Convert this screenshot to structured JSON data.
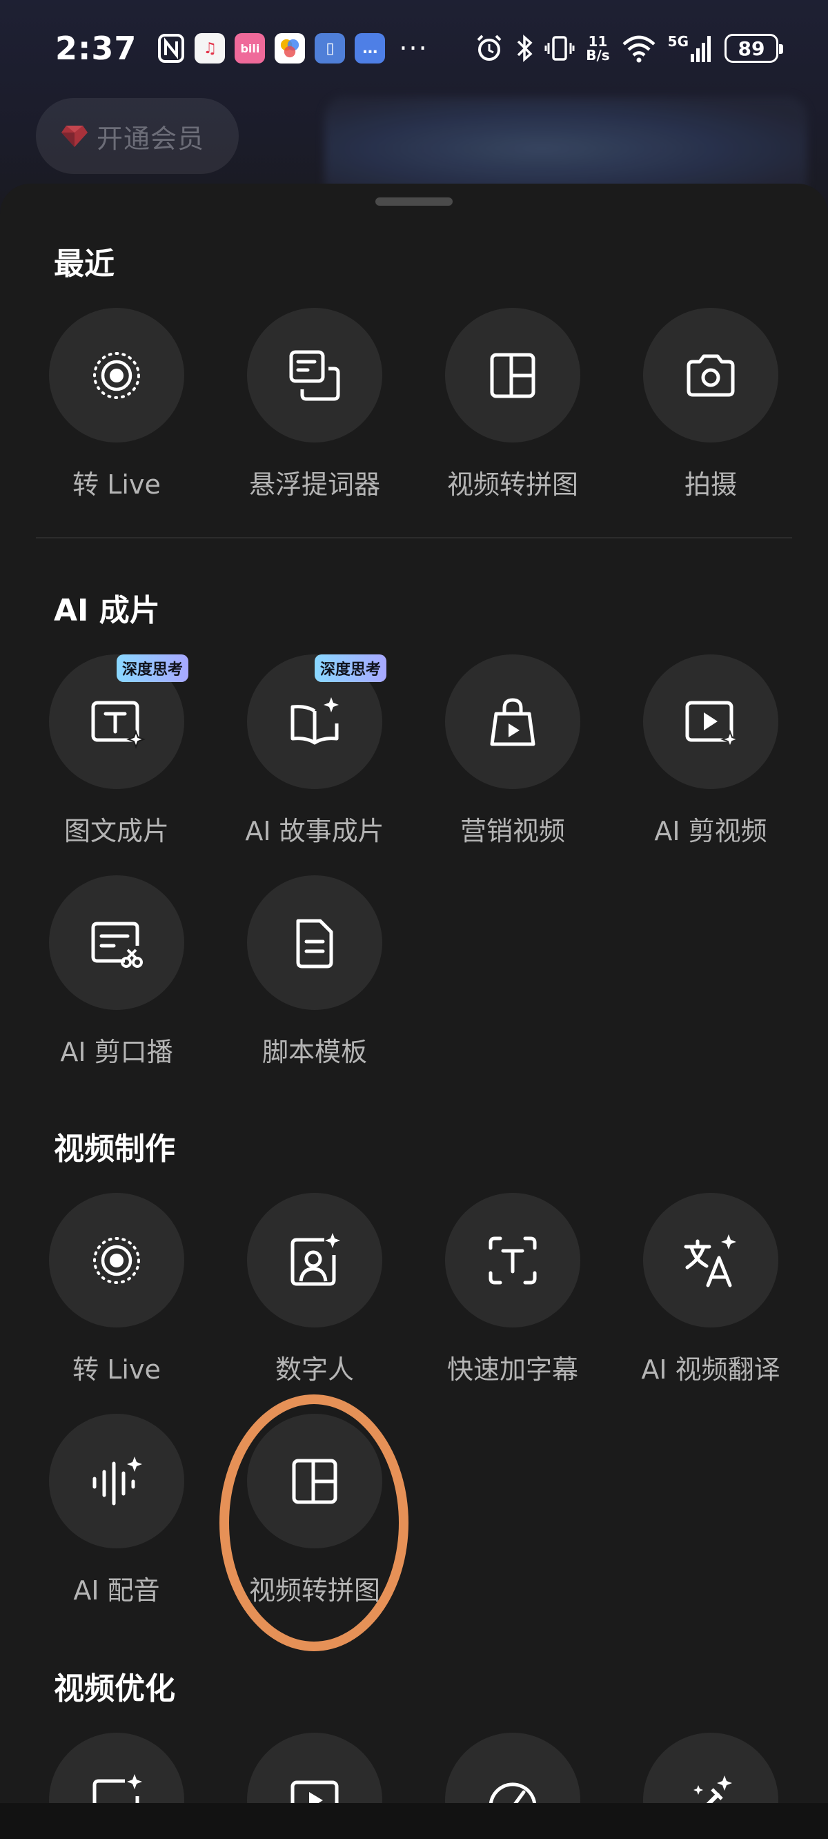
{
  "status_bar": {
    "time": "2:37",
    "net_speed_value": "11",
    "net_speed_unit": "B/s",
    "network_type": "5G",
    "battery": "89",
    "more": "···"
  },
  "background": {
    "vip_label": "开通会员"
  },
  "sections": [
    {
      "title": "最近",
      "items": [
        {
          "label": "转 Live",
          "icon": "live-icon"
        },
        {
          "label": "悬浮提词器",
          "icon": "teleprompter-icon"
        },
        {
          "label": "视频转拼图",
          "icon": "collage-icon"
        },
        {
          "label": "拍摄",
          "icon": "camera-icon"
        }
      ]
    },
    {
      "title": "AI 成片",
      "items": [
        {
          "label": "图文成片",
          "icon": "text-to-video-icon",
          "badge": "深度思考"
        },
        {
          "label": "AI 故事成片",
          "icon": "story-book-icon",
          "badge": "深度思考"
        },
        {
          "label": "营销视频",
          "icon": "shopping-bag-icon"
        },
        {
          "label": "AI 剪视频",
          "icon": "ai-edit-video-icon"
        },
        {
          "label": "AI 剪口播",
          "icon": "ai-cut-talk-icon"
        },
        {
          "label": "脚本模板",
          "icon": "script-doc-icon"
        }
      ]
    },
    {
      "title": "视频制作",
      "items": [
        {
          "label": "转 Live",
          "icon": "live-icon"
        },
        {
          "label": "数字人",
          "icon": "digital-human-icon"
        },
        {
          "label": "快速加字幕",
          "icon": "subtitle-icon"
        },
        {
          "label": "AI 视频翻译",
          "icon": "translate-icon"
        },
        {
          "label": "AI 配音",
          "icon": "voiceover-icon"
        },
        {
          "label": "视频转拼图",
          "icon": "collage-icon"
        }
      ]
    },
    {
      "title": "视频优化",
      "items": [
        {
          "icon": "enhance-icon"
        },
        {
          "icon": "play-frame-icon"
        },
        {
          "icon": "speed-gauge-icon"
        },
        {
          "icon": "magic-wand-icon"
        }
      ]
    }
  ],
  "colors": {
    "sheet_bg": "#1b1b1b",
    "tile_bg": "#2c2c2c",
    "highlight": "#e69157",
    "badge_gradient_start": "#8ad8ff",
    "badge_gradient_end": "#a8a8ff"
  }
}
